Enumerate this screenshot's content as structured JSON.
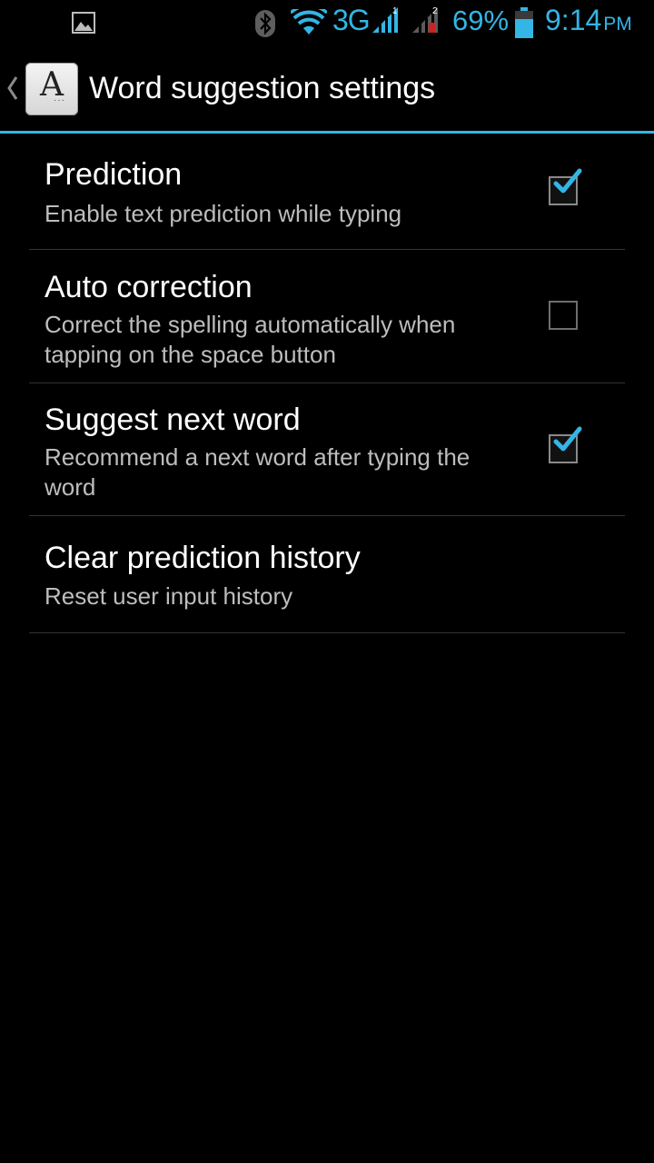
{
  "status_bar": {
    "network": "3G",
    "sim1_label": "1",
    "sim2_label": "2",
    "battery_percent": "69%",
    "time": "9:14",
    "ampm": "PM",
    "accent_color": "#33b5e5"
  },
  "action_bar": {
    "title": "Word suggestion settings",
    "app_icon_glyph": "A",
    "up_icon": "chevron-left-icon"
  },
  "preferences": [
    {
      "title": "Prediction",
      "summary": "Enable text prediction while typing",
      "checked": true
    },
    {
      "title": "Auto correction",
      "summary": "Correct the spelling automatically when tapping on the space button",
      "checked": false
    },
    {
      "title": "Suggest next word",
      "summary": "Recommend a next word after typing the word",
      "checked": true
    },
    {
      "title": "Clear prediction history",
      "summary": "Reset user input history"
    }
  ],
  "colors": {
    "background": "#000000",
    "divider": "#333333",
    "summary_text": "#bdbdbd",
    "check_accent": "#33b5e5"
  }
}
